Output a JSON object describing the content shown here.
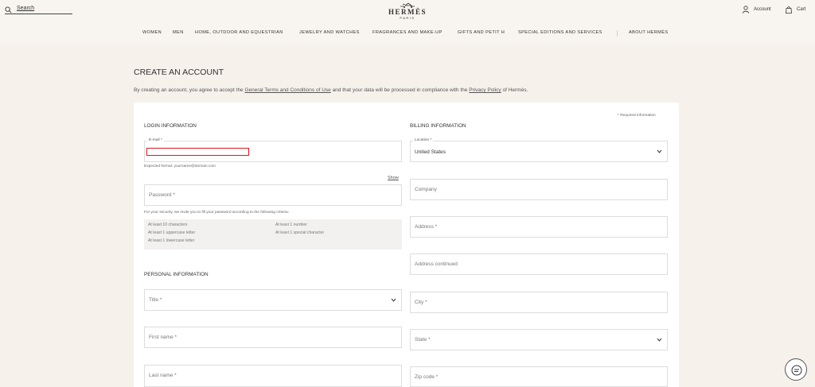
{
  "header": {
    "search_placeholder": "Search",
    "logo_name": "HERMÈS",
    "logo_city": "PARIS",
    "account_label": "Account",
    "cart_label": "Cart"
  },
  "nav": {
    "items": [
      "WOMEN",
      "MEN",
      "HOME, OUTDOOR AND EQUESTRIAN",
      "JEWELRY AND WATCHES",
      "FRAGRANCES AND MAKE-UP",
      "GIFTS AND PETIT H",
      "SPECIAL EDITIONS AND SERVICES",
      "ABOUT HERMÈS"
    ]
  },
  "page": {
    "title": "CREATE AN ACCOUNT",
    "intro_before": "By creating an account, you agree to accept the ",
    "terms_link": "General Terms and Conditions of Use",
    "intro_middle": " and that your data will be processed in compliance with the ",
    "privacy_link": "Privacy Policy",
    "intro_after": " of Hermès."
  },
  "form": {
    "required_note": "* Required information",
    "login": {
      "title": "LOGIN INFORMATION",
      "email_label": "E-mail *",
      "email_hint": "Expected format: yourname@domain.com",
      "show_label": "Show",
      "password_placeholder": "Password *",
      "password_note": "For your security, we invite you to fill your password according to the following criteria:",
      "criteria": [
        "At least 10 characters",
        "At least 1 uppercase letter",
        "At least 1 lowercase letter",
        "At least 1 number",
        "At least 1 special character"
      ]
    },
    "personal": {
      "title": "PERSONAL INFORMATION",
      "title_placeholder": "Title *",
      "first_name_placeholder": "First name *",
      "last_name_placeholder": "Last name *"
    },
    "billing": {
      "title": "BILLING INFORMATION",
      "location_label": "Location *",
      "location_value": "United States",
      "company_placeholder": "Company",
      "address_placeholder": "Address *",
      "address_continued_placeholder": "Address continued",
      "city_placeholder": "City *",
      "state_placeholder": "State *",
      "zip_placeholder": "Zip code *"
    }
  },
  "colors": {
    "background": "#f6f1eb",
    "card": "#ffffff",
    "highlight": "#d71920"
  },
  "icons": [
    "search-icon",
    "logo-carriage-icon",
    "account-icon",
    "cart-icon",
    "chevron-down-icon",
    "chat-icon"
  ]
}
